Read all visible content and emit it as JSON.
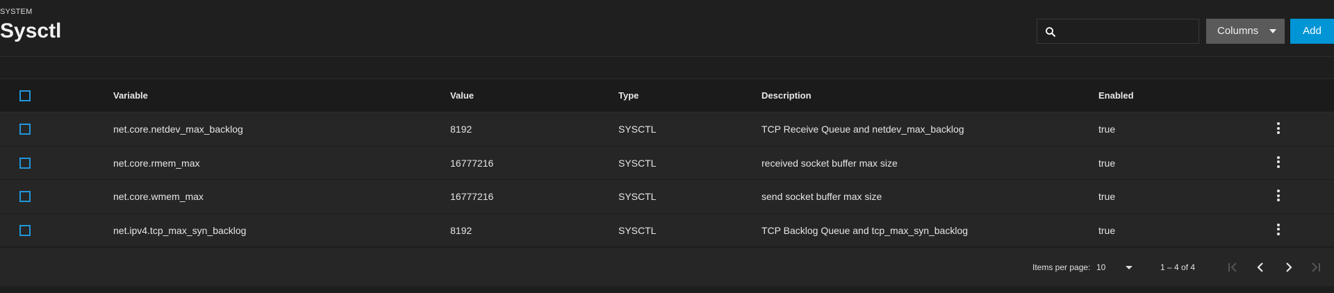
{
  "header": {
    "breadcrumb": "SYSTEM",
    "title": "Sysctl"
  },
  "toolbar": {
    "search_placeholder": "",
    "columns_label": "Columns",
    "add_label": "Add"
  },
  "table": {
    "columns": [
      "Variable",
      "Value",
      "Type",
      "Description",
      "Enabled"
    ],
    "rows": [
      {
        "variable": "net.core.netdev_max_backlog",
        "value": "8192",
        "type": "SYSCTL",
        "description": "TCP Receive Queue and netdev_max_backlog",
        "enabled": "true"
      },
      {
        "variable": "net.core.rmem_max",
        "value": "16777216",
        "type": "SYSCTL",
        "description": "received socket buffer max size",
        "enabled": "true"
      },
      {
        "variable": "net.core.wmem_max",
        "value": "16777216",
        "type": "SYSCTL",
        "description": "send socket buffer max size",
        "enabled": "true"
      },
      {
        "variable": "net.ipv4.tcp_max_syn_backlog",
        "value": "8192",
        "type": "SYSCTL",
        "description": "TCP Backlog Queue and tcp_max_syn_backlog",
        "enabled": "true"
      }
    ]
  },
  "pagination": {
    "items_per_page_label": "Items per page:",
    "items_per_page": "10",
    "range": "1 – 4 of 4"
  },
  "colors": {
    "accent": "#0095d5",
    "checkbox": "#2196d8",
    "columns_button": "#5a5a5a"
  },
  "icons": {
    "search": "search-icon",
    "caret": "caret-down-icon",
    "row_menu": "more-vert-icon",
    "first_page": "first-page-icon",
    "prev_page": "chevron-left-icon",
    "next_page": "chevron-right-icon",
    "last_page": "last-page-icon"
  }
}
